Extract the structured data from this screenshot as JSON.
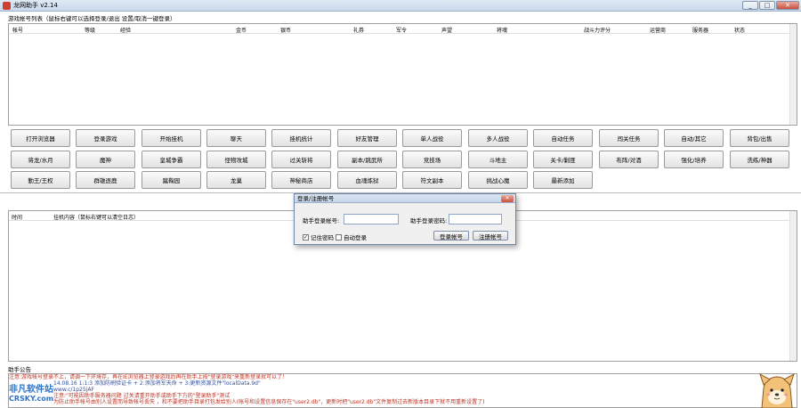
{
  "window": {
    "title": "龙网助手 v2.14",
    "minimize": "_",
    "maximize": "□",
    "close": "✕"
  },
  "accounts": {
    "label": "游戏帐号列表（鼠标右键可以选择登录/退出 设置/取消一键登录）",
    "columns": [
      "帐号",
      "等级",
      "经验",
      "金币",
      "银币",
      "礼券",
      "军令",
      "声望",
      "将魂",
      "战斗力评分",
      "运营商",
      "服务器",
      "状态"
    ]
  },
  "actions": {
    "row1": [
      "打开浏览器",
      "登录游戏",
      "开始挂机",
      "聊天",
      "挂机统计",
      "好友管理",
      "单人战役",
      "多人战役",
      "自动任务",
      "闯关任务",
      "自动/其它",
      "背包/出售"
    ],
    "row2": [
      "将龙/水月",
      "魔神",
      "皇城争霸",
      "怪物攻城",
      "过关斩将",
      "副本/跳武所",
      "竞技场",
      "斗地主",
      "关卡/剿匪",
      "布阵/对酒",
      "强化/培养",
      "洗练/神器"
    ],
    "row3": [
      "勤王/王权",
      "群雄逐鹿",
      "蹴鞠园",
      "龙巢",
      "神秘商店",
      "血魂炼狱",
      "符文副本",
      "挑战心魔",
      "最新添加"
    ]
  },
  "log": {
    "col_time": "时间",
    "col_content": "挂机内容（鼠标右键可以清空日志）"
  },
  "notice": {
    "label": "助手公告",
    "lines": [
      "注意:游戏帐号登录不上，请调一下环境存，再在IE浏览器上登录游戏后再在助手上按\"登录游戏\"来重新登录就可以了！",
      "14.08.16 1:1:3 添加防刷验证卡 + 2:添加将军天命 + 3:更新资源文件\"localData.9d\"",
      "www.c/1p25jAF",
      "注意:\"可能因助手服务器问题 过关请重开助手或助手下方的\"登录助手\"测试",
      "为防止助手帐号由别人设置而导致帐号丢失 ，和不要把助手目录打包发给别人(帐号和设置信息保存在\"user2.db\"，更新时把\"user2.db\"文件复制过去新版本目录下就不用重新设置了)"
    ]
  },
  "login_dialog": {
    "title": "登录/注册帐号",
    "account_label": "助手登录帐号:",
    "password_label": "助手登录密码:",
    "account_value": "",
    "password_value": "",
    "remember_label": "记住密码",
    "remember_checked": "✓",
    "auto_login_label": "自动登录",
    "login_button": "登录帐号",
    "register_button": "注册帐号"
  },
  "watermark": {
    "brand": "非凡软件站",
    "domain": "CRSKY.com"
  }
}
